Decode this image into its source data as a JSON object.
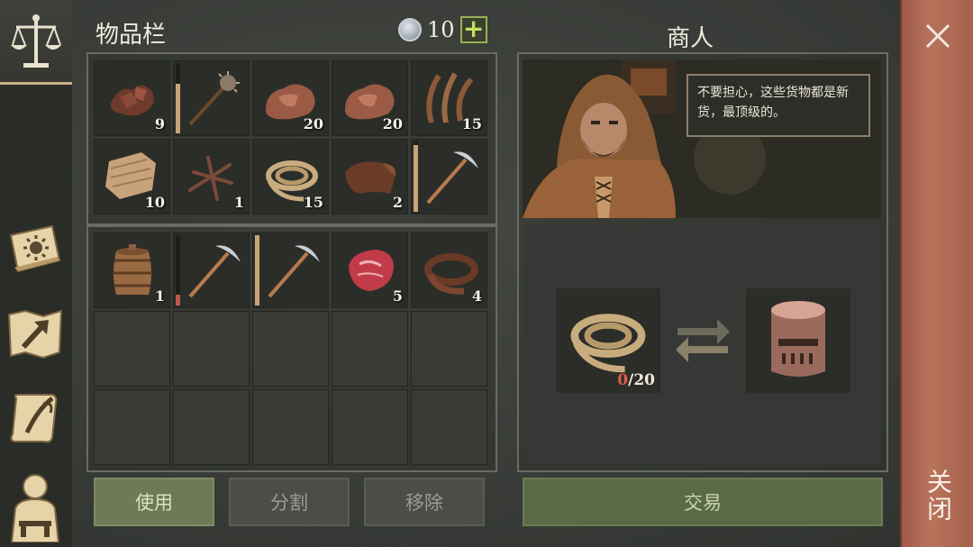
{
  "inventory": {
    "title": "物品栏",
    "currency": {
      "count": "10",
      "icon": "silver-coin-icon",
      "add_icon": "plus-icon"
    },
    "top_slots": [
      {
        "item": "leather-scraps",
        "qty": "9"
      },
      {
        "item": "mace",
        "qty": "",
        "durability": 0.7
      },
      {
        "item": "copper-ore",
        "qty": "20"
      },
      {
        "item": "copper-ore",
        "qty": "20"
      },
      {
        "item": "fiber",
        "qty": "15"
      },
      {
        "item": "cloth",
        "qty": "10"
      },
      {
        "item": "nails",
        "qty": "1"
      },
      {
        "item": "rope",
        "qty": "15"
      },
      {
        "item": "leather",
        "qty": "2"
      },
      {
        "item": "pickaxe",
        "qty": "",
        "durability": 0.95
      }
    ],
    "bottom_slots": [
      {
        "item": "barrel",
        "qty": "1"
      },
      {
        "item": "pickaxe",
        "qty": "",
        "durability": 0.15,
        "dur_color": "#c0584a"
      },
      {
        "item": "pickaxe",
        "qty": "",
        "durability": 1.0
      },
      {
        "item": "raw-meat",
        "qty": "5"
      },
      {
        "item": "leather-strap",
        "qty": "4"
      }
    ],
    "empty_slots": 10,
    "buttons": {
      "use": "使用",
      "split": "分割",
      "remove": "移除"
    }
  },
  "merchant": {
    "title": "商人",
    "speech": "不要担心，这些货物都是新货，最顶级的。",
    "trade": {
      "give_item": "rope",
      "have": "0",
      "need": "/20",
      "receive_item": "knight-helmet",
      "button": "交易"
    }
  },
  "close": {
    "label": "关闭",
    "icon": "close-icon"
  },
  "sidebar": [
    "scales-icon",
    "crafting-book-icon",
    "map-icon",
    "quest-scroll-icon",
    "character-icon"
  ]
}
